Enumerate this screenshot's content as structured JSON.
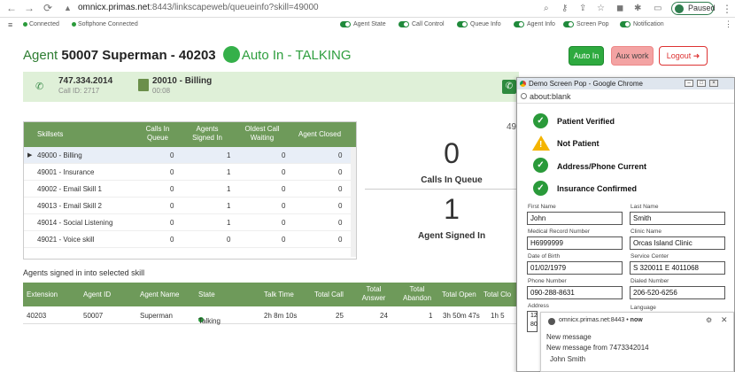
{
  "browser": {
    "url_host": "omnicx.primas.net",
    "url_path": ":8443/linkscapeweb/queueinfo?skill=49000",
    "profile_label": "Paused"
  },
  "status": {
    "connected": "Connected",
    "softphone": "Softphone Connected",
    "toggles": [
      "Agent State",
      "Call Control",
      "Queue Info",
      "Agent Info",
      "Screen Pop",
      "Notification"
    ]
  },
  "agent": {
    "label": "Agent",
    "id_name": "50007 Superman - 40203",
    "state": "Auto In",
    "activity": "- TALKING"
  },
  "buttons": {
    "auto_in": "Auto In",
    "aux_work": "Aux work",
    "logout": "Logout"
  },
  "call": {
    "number": "747.334.2014",
    "call_id": "Call ID: 2717",
    "skill": "20010 - Billing",
    "timer": "00:08"
  },
  "skillsets": {
    "headers": [
      "Skillsets",
      "Calls In Queue",
      "Agents Signed In",
      "Oldest Call Waiting",
      "Agent Closed"
    ],
    "rows": [
      {
        "name": "49000 - Billing",
        "queue": "0",
        "signed": "1",
        "oldest": "0",
        "closed": "0"
      },
      {
        "name": "49001 - Insurance",
        "queue": "0",
        "signed": "1",
        "oldest": "0",
        "closed": "0"
      },
      {
        "name": "49002 - Email Skill 1",
        "queue": "0",
        "signed": "1",
        "oldest": "0",
        "closed": "0"
      },
      {
        "name": "49013 - Email Skill 2",
        "queue": "0",
        "signed": "1",
        "oldest": "0",
        "closed": "0"
      },
      {
        "name": "49014 - Social Listening",
        "queue": "0",
        "signed": "1",
        "oldest": "0",
        "closed": "0"
      },
      {
        "name": "49021 - Voice skill",
        "queue": "0",
        "signed": "0",
        "oldest": "0",
        "closed": "0"
      }
    ]
  },
  "stats": {
    "calls_in_queue_value": "0",
    "calls_in_queue_label": "Calls In Queue",
    "agents_signed_value": "1",
    "agents_signed_label": "Agent Signed In",
    "cut_text": "49"
  },
  "agents": {
    "title": "Agents signed in into selected skill",
    "headers": [
      "Extension",
      "Agent ID",
      "Agent Name",
      "State",
      "Talk Time",
      "Total Call",
      "Total Answer",
      "Total Abandon",
      "Total Open",
      "Total Clo"
    ],
    "row": {
      "extension": "40203",
      "agent_id": "50007",
      "name": "Superman",
      "state": "Talking",
      "talk_time": "2h 8m 10s",
      "total_call": "25",
      "total_answer": "24",
      "total_abandon": "1",
      "total_open": "3h 50m 47s",
      "total_close": "1h 5"
    }
  },
  "popup": {
    "title": "Demo Screen Pop - Google Chrome",
    "url": "about:blank",
    "verifications": [
      {
        "label": "Patient Verified",
        "status": "ok"
      },
      {
        "label": "Not Patient",
        "status": "warning"
      },
      {
        "label": "Address/Phone Current",
        "status": "ok"
      },
      {
        "label": "Insurance Confirmed",
        "status": "ok"
      }
    ],
    "fields": {
      "first_name_label": "First Name",
      "first_name": "John",
      "last_name_label": "Last Name",
      "last_name": "Smith",
      "mrn_label": "Medical Record Number",
      "mrn": "H6999999",
      "clinic_label": "Clinic Name",
      "clinic": "Orcas Island Clinic",
      "dob_label": "Date of Birth",
      "dob": "01/02/1979",
      "service_label": "Service Center",
      "service": "S 320011 E 4011068",
      "phone_label": "Phone Number",
      "phone": "090-288-8631",
      "dialed_label": "Dialed Number",
      "dialed": "206-520-6256",
      "address_label": "Address",
      "address": "12\n80",
      "language_label": "Language"
    },
    "notification": {
      "source": "omnicx.primas.net:8443",
      "when": "now",
      "title": "New message",
      "body": "New message from 7473342014",
      "name": "John Smith"
    }
  }
}
